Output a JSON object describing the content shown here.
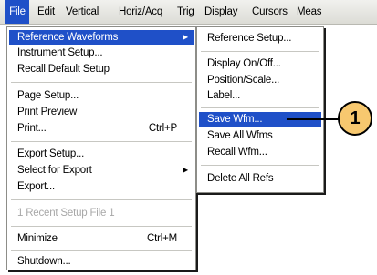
{
  "menubar": {
    "items": [
      "File",
      "Edit",
      "Vertical",
      "Horiz/Acq",
      "Trig",
      "Display",
      "Cursors",
      "Meas"
    ]
  },
  "file_menu": {
    "items": [
      {
        "label": "Reference Waveforms",
        "shortcut": "",
        "submenu": true,
        "highlighted": true,
        "disabled": false
      },
      {
        "label": "Instrument Setup...",
        "shortcut": "",
        "submenu": false,
        "highlighted": false,
        "disabled": false
      },
      {
        "label": "Recall Default Setup",
        "shortcut": "",
        "submenu": false,
        "highlighted": false,
        "disabled": false
      },
      {
        "label": "Page Setup...",
        "shortcut": "",
        "submenu": false,
        "highlighted": false,
        "disabled": false
      },
      {
        "label": "Print Preview",
        "shortcut": "",
        "submenu": false,
        "highlighted": false,
        "disabled": false
      },
      {
        "label": "Print...",
        "shortcut": "Ctrl+P",
        "submenu": false,
        "highlighted": false,
        "disabled": false
      },
      {
        "label": "Export Setup...",
        "shortcut": "",
        "submenu": false,
        "highlighted": false,
        "disabled": false
      },
      {
        "label": "Select for Export",
        "shortcut": "",
        "submenu": true,
        "highlighted": false,
        "disabled": false
      },
      {
        "label": "Export...",
        "shortcut": "",
        "submenu": false,
        "highlighted": false,
        "disabled": false
      },
      {
        "label": "1 Recent Setup File 1",
        "shortcut": "",
        "submenu": false,
        "highlighted": false,
        "disabled": true
      },
      {
        "label": "Minimize",
        "shortcut": "Ctrl+M",
        "submenu": false,
        "highlighted": false,
        "disabled": false
      },
      {
        "label": "Shutdown...",
        "shortcut": "",
        "submenu": false,
        "highlighted": false,
        "disabled": false
      }
    ]
  },
  "ref_submenu": {
    "items": [
      {
        "label": "Reference Setup...",
        "highlighted": false
      },
      {
        "label": "Display On/Off...",
        "highlighted": false
      },
      {
        "label": "Position/Scale...",
        "highlighted": false
      },
      {
        "label": "Label...",
        "highlighted": false
      },
      {
        "label": "Save Wfm...",
        "highlighted": true
      },
      {
        "label": "Save All Wfms",
        "highlighted": false
      },
      {
        "label": "Recall Wfm...",
        "highlighted": false
      },
      {
        "label": "Delete All Refs",
        "highlighted": false
      }
    ]
  },
  "callout": {
    "number": "1"
  },
  "icons": {
    "submenu_arrow": "triangle-right"
  },
  "colors": {
    "highlight": "#1f50c8",
    "callout_fill": "#f7c86f"
  }
}
